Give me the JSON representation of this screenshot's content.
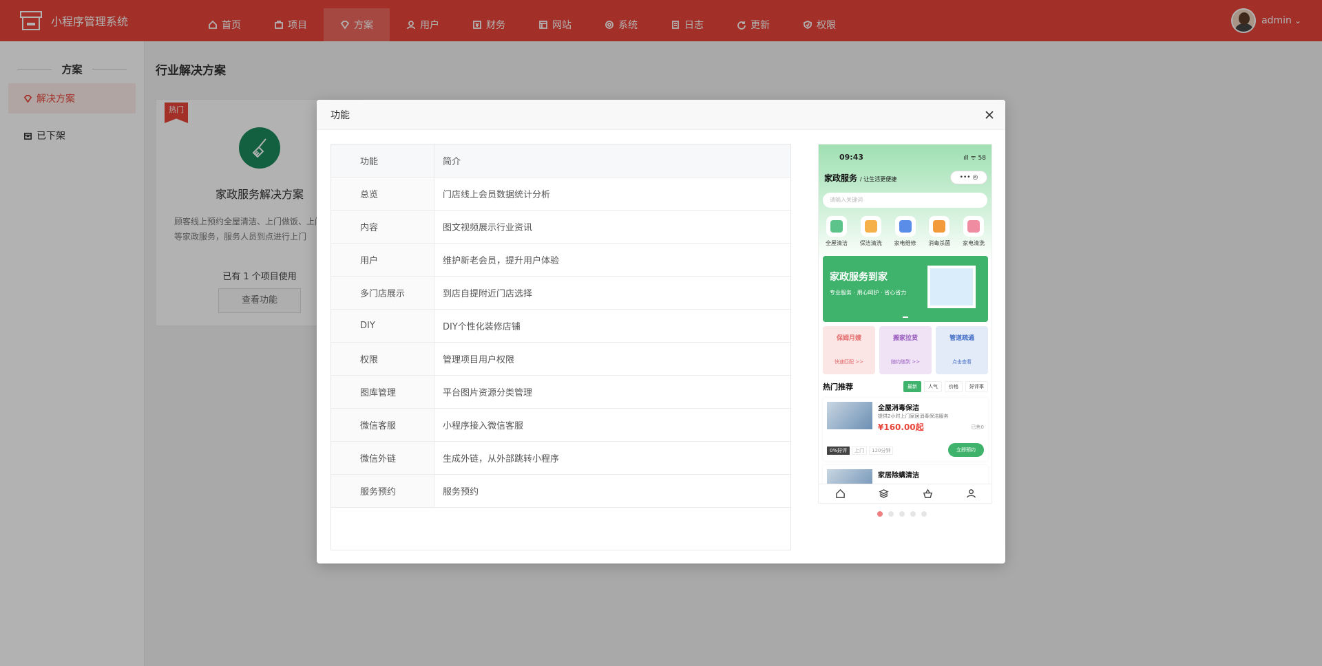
{
  "app": {
    "name": "小程序管理系统"
  },
  "nav": [
    {
      "label": "首页",
      "icon": "home-icon"
    },
    {
      "label": "项目",
      "icon": "briefcase-icon"
    },
    {
      "label": "方案",
      "icon": "diamond-icon",
      "active": true
    },
    {
      "label": "用户",
      "icon": "user-icon"
    },
    {
      "label": "财务",
      "icon": "finance-icon"
    },
    {
      "label": "网站",
      "icon": "website-icon"
    },
    {
      "label": "系统",
      "icon": "system-icon"
    },
    {
      "label": "日志",
      "icon": "log-icon"
    },
    {
      "label": "更新",
      "icon": "refresh-icon"
    },
    {
      "label": "权限",
      "icon": "shield-icon"
    }
  ],
  "user": {
    "name": "admin",
    "caret": "⌄"
  },
  "sidebar": {
    "title": "方案",
    "items": [
      {
        "label": "解决方案",
        "active": true
      },
      {
        "label": "已下架"
      }
    ]
  },
  "main": {
    "title": "行业解决方案",
    "card": {
      "badge": "热门",
      "name": "家政服务解决方案",
      "desc": "顾客线上预约全屋清洁、上门做饭、上门洗衣等家政服务，服务人员到点进行上门",
      "usage": "已有 1 个项目使用",
      "button": "查看功能"
    }
  },
  "modal": {
    "title": "功能",
    "table": {
      "headers": [
        "功能",
        "简介"
      ],
      "rows": [
        [
          "总览",
          "门店线上会员数据统计分析"
        ],
        [
          "内容",
          "图文视频展示行业资讯"
        ],
        [
          "用户",
          "维护新老会员，提升用户体验"
        ],
        [
          "多门店展示",
          "到店自提附近门店选择"
        ],
        [
          "DIY",
          "DIY个性化装修店铺"
        ],
        [
          "权限",
          "管理项目用户权限"
        ],
        [
          "图库管理",
          "平台图片资源分类管理"
        ],
        [
          "微信客服",
          "小程序接入微信客服"
        ],
        [
          "微信外链",
          "生成外链，从外部跳转小程序"
        ],
        [
          "服务预约",
          "服务预约"
        ]
      ]
    },
    "preview": {
      "time": "09:43",
      "status": "ıll ᯤ 58",
      "title": "家政服务",
      "slogan": "/ 让生活更便捷",
      "capsule": "•••  ◎",
      "search_placeholder": "请输入关键词",
      "categories": [
        {
          "label": "全屋清洁",
          "color": "#5cc48a"
        },
        {
          "label": "保洁清洗",
          "color": "#f6b04a"
        },
        {
          "label": "家电维修",
          "color": "#5a8de8"
        },
        {
          "label": "消毒杀菌",
          "color": "#f39a3c"
        },
        {
          "label": "家电清洗",
          "color": "#ef8ca2"
        }
      ],
      "banner": {
        "title": "家政服务到家",
        "subtitle": "专业服务 · 用心呵护 · 省心省力"
      },
      "promos": [
        {
          "title": "保姆月嫂",
          "sub": "快速匹配 >>",
          "bg": "#fbe5e5",
          "color": "#e46a6a"
        },
        {
          "title": "搬家拉货",
          "sub": "随约随到 >>",
          "bg": "#efe3f5",
          "color": "#9a5cc0"
        },
        {
          "title": "管道疏通",
          "sub": "点击查看",
          "bg": "#e3ebf9",
          "color": "#4a72c8"
        }
      ],
      "hot": {
        "title": "热门推荐",
        "tabs": [
          "最新",
          "人气",
          "价格",
          "好评率"
        ]
      },
      "items": [
        {
          "name": "全屋消毒保洁",
          "desc": "提供2小时上门家居消毒保洁服务",
          "price": "¥160.00起",
          "sold": "已售0",
          "tags": [
            "0%好评",
            "上门",
            "120分钟"
          ],
          "button": "立即预约"
        },
        {
          "name": "家居除螨清洁"
        }
      ]
    },
    "pager": {
      "count": 5,
      "active": 0
    }
  }
}
